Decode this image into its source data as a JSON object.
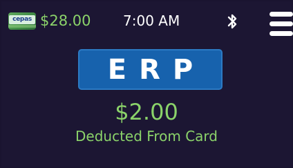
{
  "status_bar": {
    "card_label": "cepas",
    "balance": "$28.00",
    "time": "7:00 AM",
    "bluetooth_icon": "bluetooth-icon",
    "menu_icon": "hamburger-menu-icon"
  },
  "main": {
    "badge_text": "ERP",
    "amount": "$2.00",
    "caption": "Deducted From Card"
  },
  "colors": {
    "background": "#1c1633",
    "accent_green": "#8bd36a",
    "badge_blue": "#1762ad",
    "text_white": "#ffffff"
  }
}
